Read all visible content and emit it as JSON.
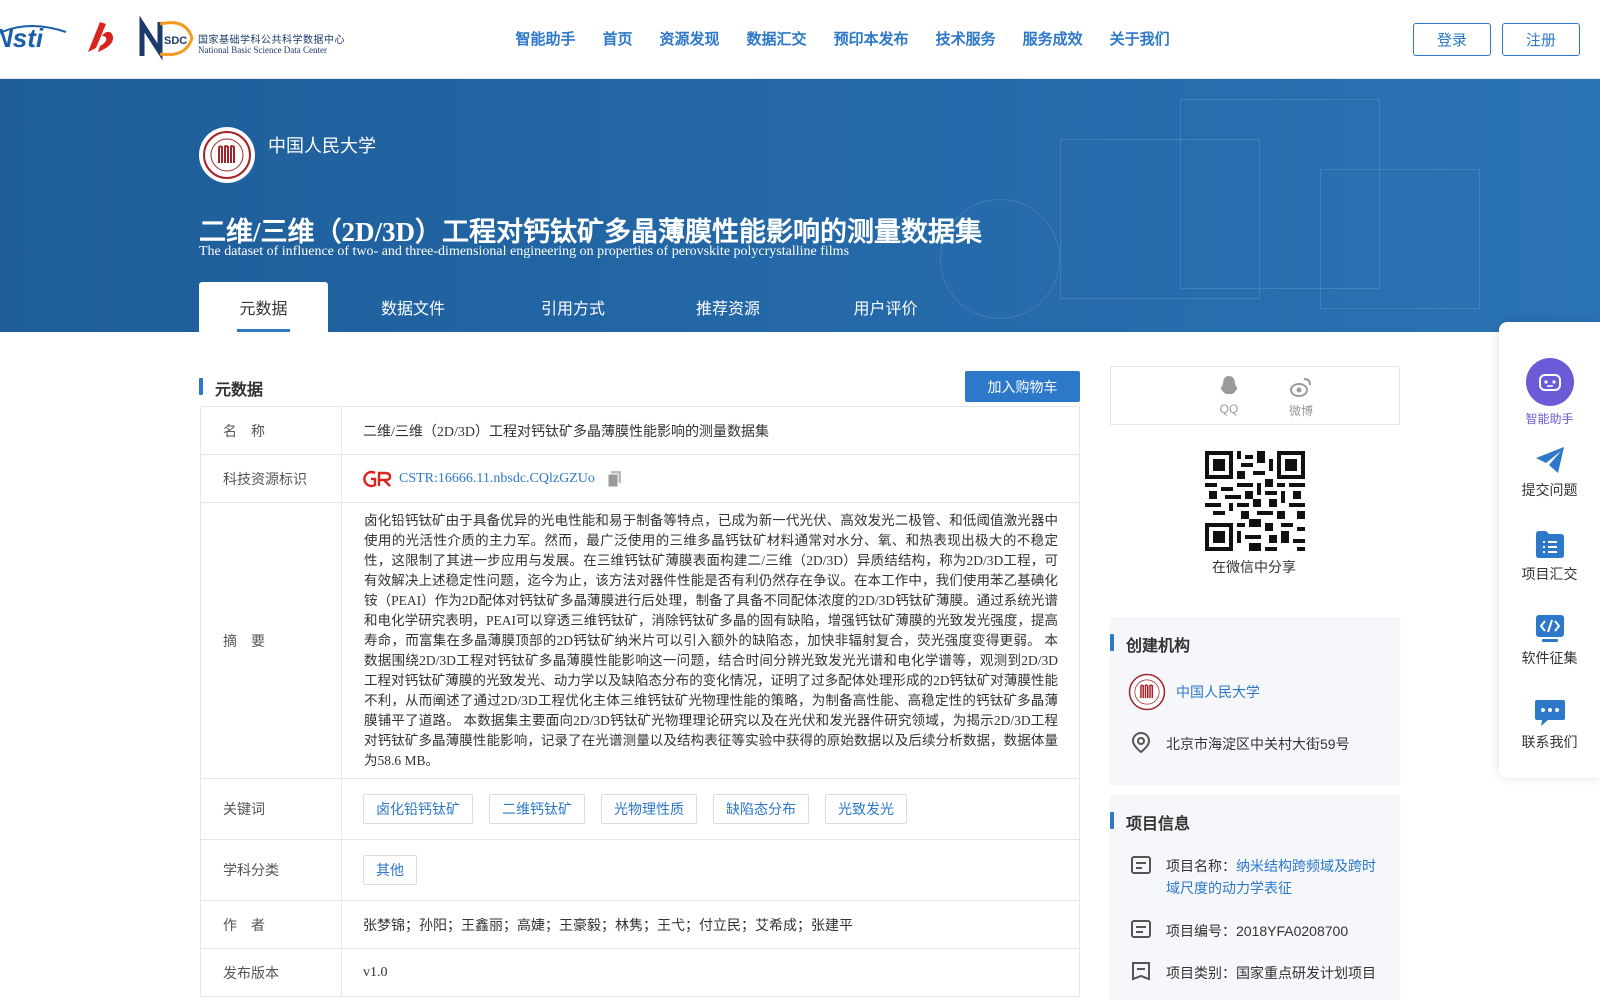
{
  "header": {
    "logos": {
      "nsti": "Nsti",
      "nsdc_cn": "国家基础学科公共科学数据中心",
      "nsdc_en": "National Basic Science Data Center",
      "nsdc_mark": "SDC"
    },
    "nav": [
      "智能助手",
      "首页",
      "资源发现",
      "数据汇交",
      "预印本发布",
      "技术服务",
      "服务成效",
      "关于我们"
    ],
    "login": "登录",
    "register": "注册"
  },
  "banner": {
    "institution": "中国人民大学",
    "title": "二维/三维（2D/3D）工程对钙钛矿多晶薄膜性能影响的测量数据集",
    "subtitle": "The dataset of influence of two- and three-dimensional engineering on properties of perovskite polycrystalline films",
    "tabs": [
      "元数据",
      "数据文件",
      "引用方式",
      "推荐资源",
      "用户评价"
    ],
    "active_tab": 0
  },
  "metadata": {
    "heading": "元数据",
    "cart_button": "加入购物车",
    "rows": {
      "name": {
        "label": "名　称",
        "value": "二维/三维（2D/3D）工程对钙钛矿多晶薄膜性能影响的测量数据集"
      },
      "cstr": {
        "label": "科技资源标识",
        "value": "CSTR:16666.11.nbsdc.CQlzGZUo"
      },
      "abstract": {
        "label": "摘　要",
        "value": "卤化铅钙钛矿由于具备优异的光电性能和易于制备等特点，已成为新一代光伏、高效发光二极管、和低阈值激光器中使用的光活性介质的主力军。然而，最广泛使用的三维多晶钙钛矿材料通常对水分、氧、和热表现出极大的不稳定性，这限制了其进一步应用与发展。在三维钙钛矿薄膜表面构建二/三维（2D/3D）异质结结构，称为2D/3D工程，可有效解决上述稳定性问题，迄今为止，该方法对器件性能是否有利仍然存在争议。在本工作中，我们使用苯乙基碘化铵（PEAI）作为2D配体对钙钛矿多晶薄膜进行后处理，制备了具备不同配体浓度的2D/3D钙钛矿薄膜。通过系统光谱和电化学研究表明，PEAI可以穿透三维钙钛矿，消除钙钛矿多晶的固有缺陷，增强钙钛矿薄膜的光致发光强度，提高寿命，而富集在多晶薄膜顶部的2D钙钛矿纳米片可以引入额外的缺陷态，加快非辐射复合，荧光强度变得更弱。 本数据围绕2D/3D工程对钙钛矿多晶薄膜性能影响这一问题，结合时间分辨光致发光光谱和电化学谱等，观测到2D/3D工程对钙钛矿薄膜的光致发光、动力学以及缺陷态分布的变化情况，证明了过多配体处理形成的2D钙钛矿对薄膜性能不利，从而阐述了通过2D/3D工程优化主体三维钙钛矿光物理性能的策略，为制备高性能、高稳定性的钙钛矿多晶薄膜铺平了道路。 本数据集主要面向2D/3D钙钛矿光物理理论研究以及在光伏和发光器件研究领域，为揭示2D/3D工程对钙钛矿多晶薄膜性能影响，记录了在光谱测量以及结构表征等实验中获得的原始数据以及后续分析数据，数据体量为58.6 MB。"
      },
      "keywords": {
        "label": "关键词",
        "tags": [
          "卤化铅钙钛矿",
          "二维钙钛矿",
          "光物理性质",
          "缺陷态分布",
          "光致发光"
        ]
      },
      "subject": {
        "label": "学科分类",
        "tags": [
          "其他"
        ]
      },
      "authors": {
        "label": "作　者",
        "value": "张梦锦；孙阳；王鑫丽；高婕；王豪毅；林隽；王弋；付立民；艾希成；张建平"
      },
      "version": {
        "label": "发布版本",
        "value": "v1.0"
      }
    }
  },
  "sidebar": {
    "share": {
      "qq": "QQ",
      "weibo": "微博",
      "wechat": "在微信中分享"
    },
    "creator": {
      "heading": "创建机构",
      "name": "中国人民大学",
      "address": "北京市海淀区中关村大街59号"
    },
    "project": {
      "heading": "项目信息",
      "name_label": "项目名称：",
      "name_line1": "纳米结构跨频域及跨时",
      "name_line2": "域尺度的动力学表征",
      "number": "项目编号：2018YFA0208700",
      "category": "项目类别：国家重点研发计划项目"
    }
  },
  "float_bar": [
    "智能助手",
    "提交问题",
    "项目汇交",
    "软件征集",
    "联系我们"
  ],
  "colors": {
    "brand": "#2d78c8",
    "banner": "#1e5d99",
    "accent_purple": "#6b5bd6",
    "nsdc_orange": "#f39a1f"
  }
}
